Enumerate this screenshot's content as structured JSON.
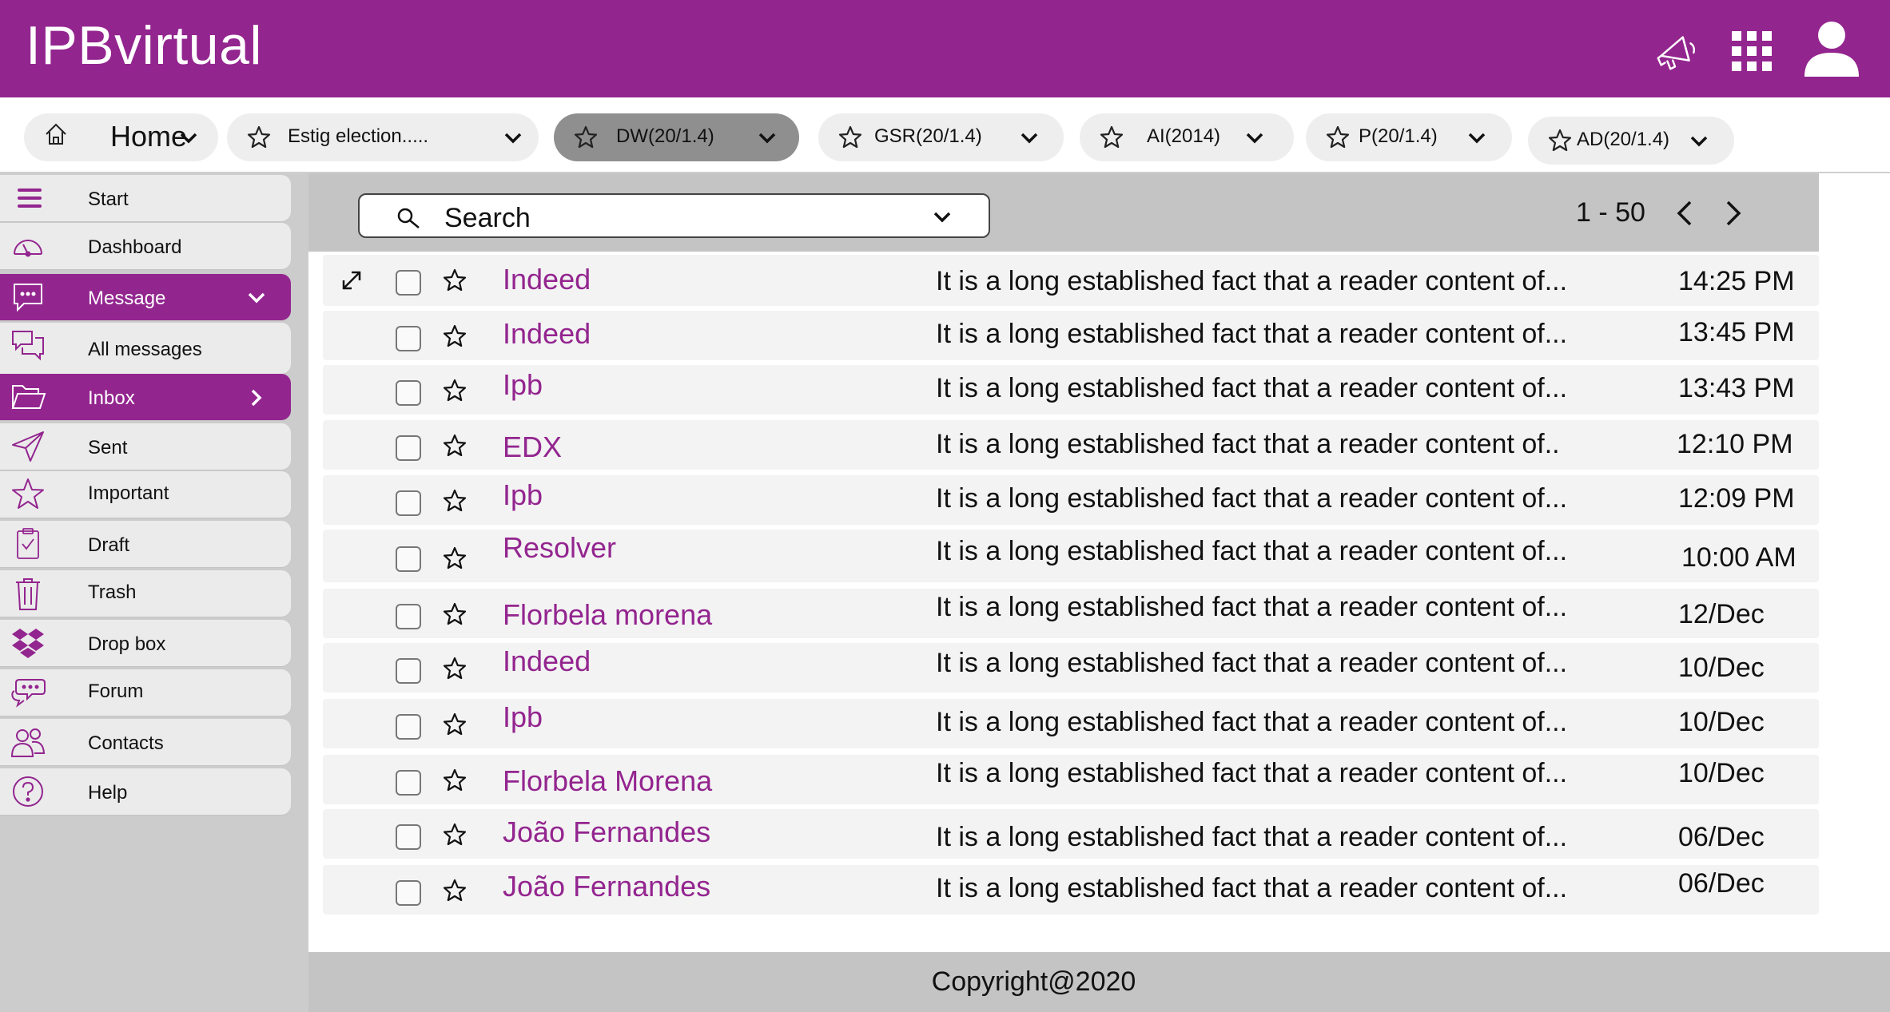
{
  "app": {
    "title": "IPBvirtual",
    "brand_color": "#93258f"
  },
  "header": {
    "icons": [
      "megaphone-icon",
      "apps-grid-icon",
      "user-account-icon"
    ]
  },
  "tabs": [
    {
      "label": "Home",
      "icon": "home-icon",
      "active": false
    },
    {
      "label": "Estig election.....",
      "icon": "star-icon",
      "active": false
    },
    {
      "label": "DW(20/1.4)",
      "icon": "star-icon",
      "active": true
    },
    {
      "label": "GSR(20/1.4)",
      "icon": "star-icon",
      "active": false
    },
    {
      "label": "AI(2014)",
      "icon": "star-icon",
      "active": false
    },
    {
      "label": "P(20/1.4)",
      "icon": "star-icon",
      "active": false
    },
    {
      "label": "AD(20/1.4)",
      "icon": "star-icon",
      "active": false
    }
  ],
  "sidebar": {
    "items": [
      {
        "label": "Start",
        "icon": "hamburger-menu-icon",
        "active": false
      },
      {
        "label": "Dashboard",
        "icon": "gauge-icon",
        "active": false
      },
      {
        "label": "Message",
        "icon": "chat-bubble-icon",
        "active": true,
        "expanded": true
      },
      {
        "label": "All messages",
        "icon": "chat-bubbles-icon",
        "active": false
      },
      {
        "label": "Inbox",
        "icon": "folder-open-icon",
        "active": true
      },
      {
        "label": "Sent",
        "icon": "paper-plane-icon",
        "active": false
      },
      {
        "label": "Important",
        "icon": "star-icon",
        "active": false
      },
      {
        "label": "Draft",
        "icon": "clipboard-check-icon",
        "active": false
      },
      {
        "label": "Trash",
        "icon": "trash-icon",
        "active": false
      },
      {
        "label": "Drop box",
        "icon": "dropbox-icon",
        "active": false
      },
      {
        "label": "Forum",
        "icon": "forum-icon",
        "active": false
      },
      {
        "label": "Contacts",
        "icon": "contacts-icon",
        "active": false
      },
      {
        "label": "Help",
        "icon": "help-icon",
        "active": false
      }
    ]
  },
  "toolbar": {
    "search_label": "Search",
    "pagination": "1 - 50"
  },
  "messages": [
    {
      "sender": "Indeed",
      "preview": "It is a long established fact that a reader content of...",
      "time": "14:25 PM"
    },
    {
      "sender": "Indeed",
      "preview": "It is a long established fact that a reader content of...",
      "time": "13:45 PM"
    },
    {
      "sender": "Ipb",
      "preview": "It is a long established fact that a reader content of...",
      "time": "13:43 PM"
    },
    {
      "sender": "EDX",
      "preview": "It is a long established fact that a reader content of..",
      "time": "12:10 PM"
    },
    {
      "sender": "Ipb",
      "preview": "It is a long established fact that a reader content of...",
      "time": "12:09 PM"
    },
    {
      "sender": "Resolver",
      "preview": "It is a long established fact that a reader content of...",
      "time": "10:00 AM"
    },
    {
      "sender": "Florbela morena",
      "preview": "It is a long established fact that a reader content of...",
      "time": "12/Dec"
    },
    {
      "sender": "Indeed",
      "preview": "It is a long established fact that a reader content of...",
      "time": "10/Dec"
    },
    {
      "sender": "Ipb",
      "preview": "It is a long established fact that a reader content of...",
      "time": "10/Dec"
    },
    {
      "sender": "Florbela Morena",
      "preview": "It is a long established fact that a reader content of...",
      "time": "10/Dec"
    },
    {
      "sender": "João Fernandes",
      "preview": "It is a long established fact that a reader content of...",
      "time": "06/Dec"
    },
    {
      "sender": "João Fernandes",
      "preview": "It is a long established fact that a reader content of...",
      "time": "06/Dec"
    }
  ],
  "footer": {
    "copyright": "Copyright@2020"
  }
}
